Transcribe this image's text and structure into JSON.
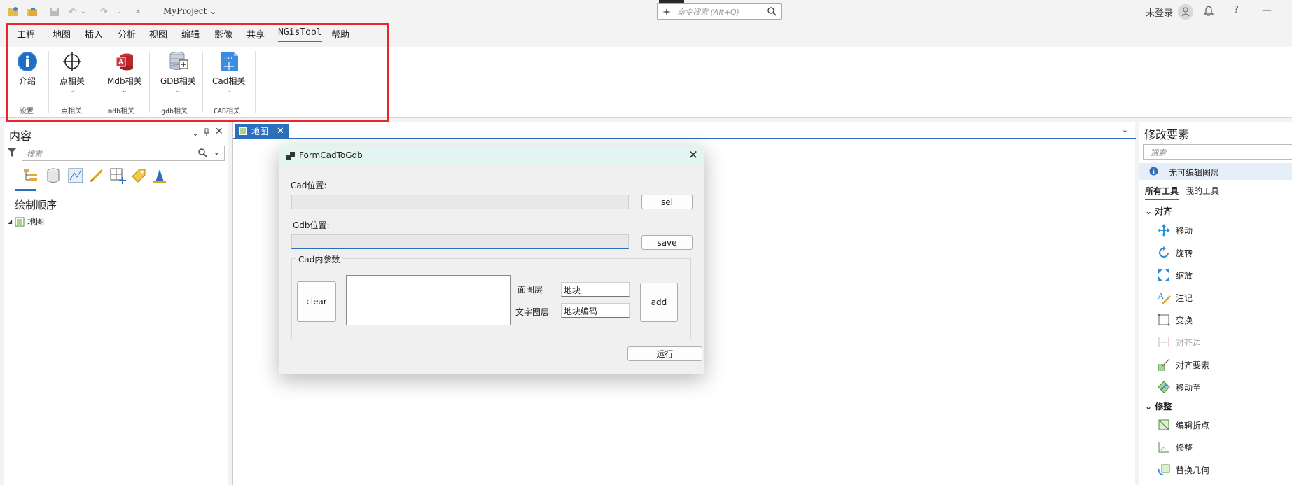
{
  "window": {
    "project": "MyProject",
    "search_placeholder": "命令搜索 (Alt+Q)",
    "user": "未登录",
    "help": "?",
    "minimize": "—"
  },
  "ribbon": {
    "tabs": [
      "工程",
      "地图",
      "插入",
      "分析",
      "视图",
      "编辑",
      "影像",
      "共享",
      "NGisTool",
      "帮助"
    ],
    "active_tab": "NGisTool",
    "buttons": {
      "intro": "介绍",
      "point": "点相关",
      "mdb": "Mdb相关",
      "gdb": "GDB相关",
      "cad": "Cad相关"
    },
    "groups": {
      "settings": "设置",
      "point": "点相关",
      "mdb": "mdb相关",
      "gdb": "gdb相关",
      "cad": "CAD相关"
    }
  },
  "contents": {
    "title": "内容",
    "search_placeholder": "搜索",
    "draw_order": "绘制顺序",
    "tree_map": "地图"
  },
  "mapview": {
    "tab_label": "地图"
  },
  "dialog": {
    "title": "FormCadToGdb",
    "cad_label": "Cad位置:",
    "cad_value": "",
    "sel_button": "sel",
    "gdb_label": "Gdb位置:",
    "gdb_value": "",
    "save_button": "save",
    "group_label": "Cad内参数",
    "clear_button": "clear",
    "polygon_layer_label": "面图层",
    "polygon_layer_value": "地块",
    "text_layer_label": "文字图层",
    "text_layer_value": "地块编码",
    "add_button": "add",
    "run_button": "运行"
  },
  "modify": {
    "title": "修改要素",
    "search_placeholder": "搜索",
    "info": "无可编辑图层",
    "tab_all": "所有工具",
    "tab_mine": "我的工具",
    "section_align": "对齐",
    "items_align": [
      "移动",
      "旋转",
      "缩放",
      "注记",
      "变换",
      "对齐边",
      "对齐要素",
      "移动至"
    ],
    "section_reshape": "修整",
    "items_reshape": [
      "编辑折点",
      "修整",
      "替换几何"
    ]
  },
  "colors": {
    "accent": "#2b6fbd",
    "highlight_box": "#e8262b",
    "dialog_title_bg": "#e4f4f0"
  }
}
